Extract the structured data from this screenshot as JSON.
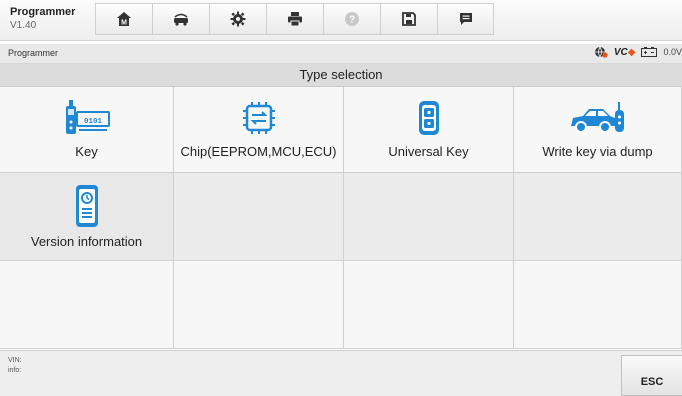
{
  "app": {
    "title": "Programmer",
    "version": "V1.40"
  },
  "toolbar": {
    "buttons": [
      {
        "icon": "home-icon"
      },
      {
        "icon": "vehicle-swap-icon"
      },
      {
        "icon": "gear-icon"
      },
      {
        "icon": "printer-icon"
      },
      {
        "icon": "help-icon"
      },
      {
        "icon": "save-icon"
      },
      {
        "icon": "message-icon"
      }
    ]
  },
  "breadcrumb": {
    "text": "Programmer"
  },
  "status": {
    "vci_label": "VC",
    "voltage": "0.0V"
  },
  "page": {
    "title": "Type selection"
  },
  "tiles": [
    {
      "label": "Key",
      "icon": "key-programmer-icon"
    },
    {
      "label": "Chip(EEPROM,MCU,ECU)",
      "icon": "chip-icon"
    },
    {
      "label": "Universal Key",
      "icon": "universal-key-icon"
    },
    {
      "label": "Write key via dump",
      "icon": "car-key-icon"
    },
    {
      "label": "Version information",
      "icon": "version-device-icon"
    }
  ],
  "footer": {
    "vin_label": "VIN:",
    "info_label": "info:",
    "esc_label": "ESC"
  },
  "colors": {
    "accent_blue": "#1e88d6",
    "warn_orange": "#e8541c"
  }
}
